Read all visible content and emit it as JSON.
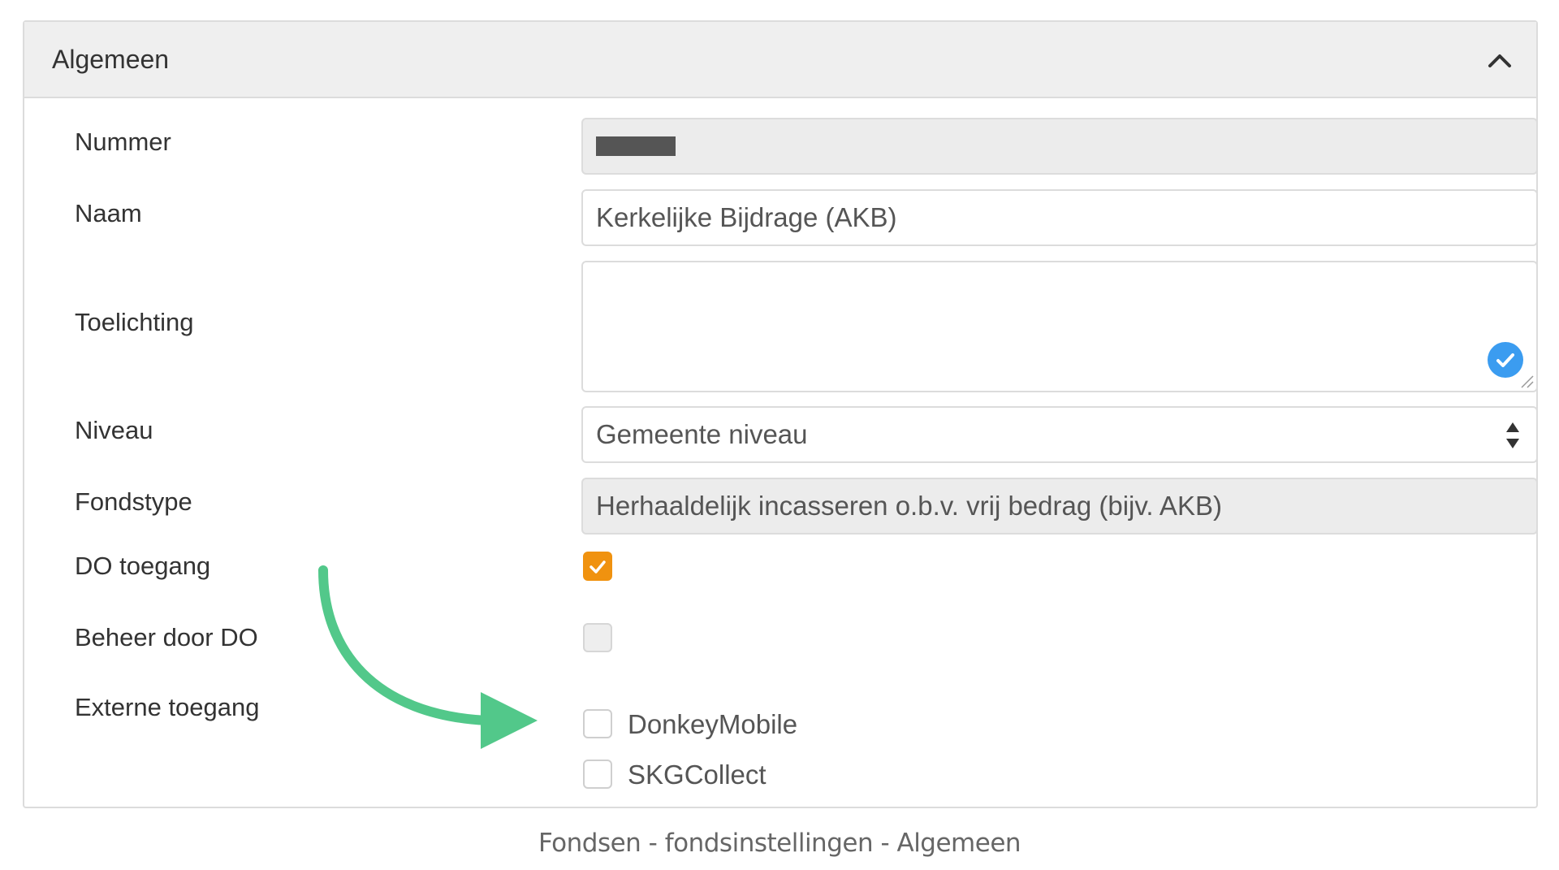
{
  "panel": {
    "title": "Algemeen",
    "collapse_icon": "chevron-up-icon"
  },
  "fields": {
    "nummer": {
      "label": "Nummer",
      "value": ""
    },
    "naam": {
      "label": "Naam",
      "value": "Kerkelijke Bijdrage (AKB)"
    },
    "toelichting": {
      "label": "Toelichting",
      "value": ""
    },
    "niveau": {
      "label": "Niveau",
      "value": "Gemeente niveau"
    },
    "fondstype": {
      "label": "Fondstype",
      "value": "Herhaaldelijk incasseren o.b.v. vrij bedrag (bijv. AKB)"
    },
    "do_toegang": {
      "label": "DO toegang",
      "checked": true
    },
    "beheer_door_do": {
      "label": "Beheer door DO",
      "checked": false
    },
    "externe_toegang": {
      "label": "Externe toegang",
      "options": [
        {
          "label": "DonkeyMobile",
          "checked": false
        },
        {
          "label": "SKGCollect",
          "checked": false
        }
      ]
    }
  },
  "colors": {
    "accent_checkbox": "#f0920f",
    "badge_blue": "#3b9cf0",
    "annotation_arrow": "#52c88a"
  },
  "caption": "Fondsen - fondsinstellingen - Algemeen"
}
